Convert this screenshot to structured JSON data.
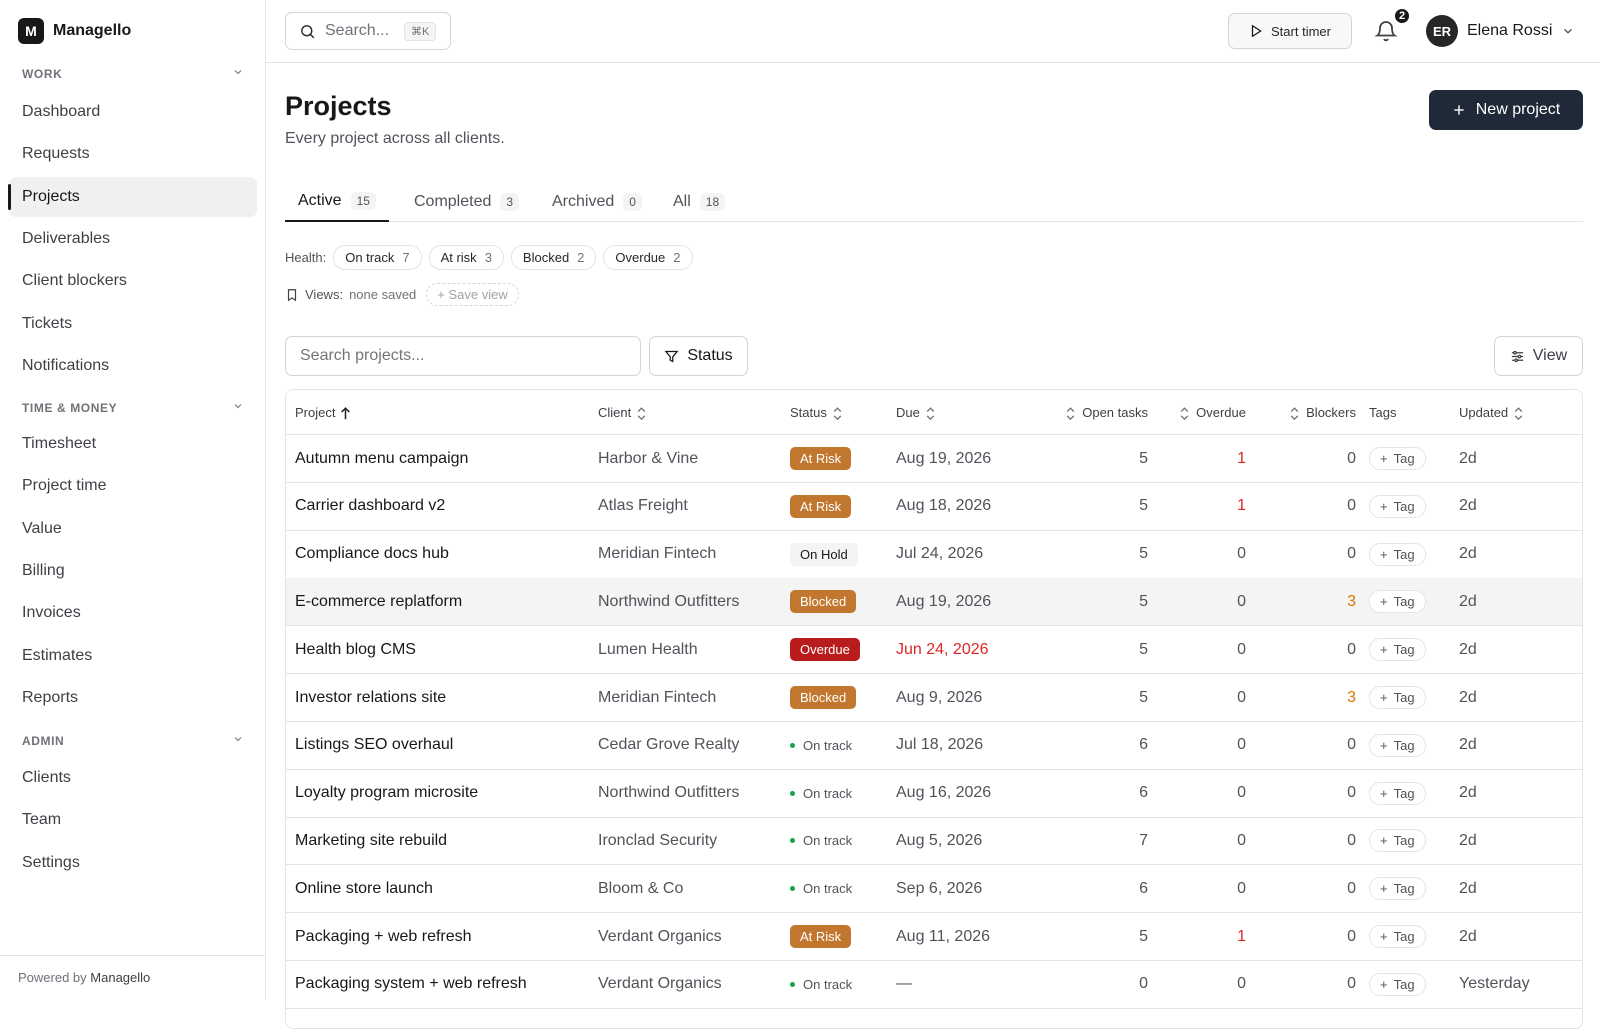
{
  "brand": {
    "logo_letter": "M",
    "name": "Managello"
  },
  "sidebar": {
    "sections": [
      {
        "title": "WORK",
        "items": [
          "Dashboard",
          "Requests",
          "Projects",
          "Deliverables",
          "Client blockers",
          "Tickets",
          "Notifications"
        ]
      },
      {
        "title": "TIME & MONEY",
        "items": [
          "Timesheet",
          "Project time",
          "Value",
          "Billing",
          "Invoices",
          "Estimates",
          "Reports"
        ]
      },
      {
        "title": "ADMIN",
        "items": [
          "Clients",
          "Team",
          "Settings"
        ]
      }
    ],
    "active_item": "Projects",
    "footer_prefix": "Powered by",
    "footer_brand": "Managello"
  },
  "topbar": {
    "search_placeholder": "Search...",
    "search_shortcut": "⌘K",
    "timer_label": "Start timer",
    "notification_count": "2",
    "user_initials": "ER",
    "user_name": "Elena Rossi"
  },
  "page": {
    "title": "Projects",
    "subtitle": "Every project across all clients.",
    "new_button": "New project"
  },
  "tabs": [
    {
      "label": "Active",
      "count": "15"
    },
    {
      "label": "Completed",
      "count": "3"
    },
    {
      "label": "Archived",
      "count": "0"
    },
    {
      "label": "All",
      "count": "18"
    }
  ],
  "health": {
    "label": "Health:",
    "chips": [
      {
        "label": "On track",
        "count": "7"
      },
      {
        "label": "At risk",
        "count": "3"
      },
      {
        "label": "Blocked",
        "count": "2"
      },
      {
        "label": "Overdue",
        "count": "2"
      }
    ]
  },
  "views": {
    "label": "Views:",
    "value": "none saved",
    "save_label": "Save view"
  },
  "filters": {
    "search_placeholder": "Search projects...",
    "status_button": "Status",
    "view_button": "View"
  },
  "table": {
    "columns": [
      "Project",
      "Client",
      "Status",
      "Due",
      "Open tasks",
      "Overdue",
      "Blockers",
      "Tags",
      "Updated"
    ],
    "tag_button": "Tag",
    "rows": [
      {
        "project": "Autumn menu campaign",
        "client": "Harbor & Vine",
        "status": "At Risk",
        "due": "Aug 19, 2026",
        "open": "5",
        "overdue": "1",
        "blockers": "0",
        "updated": "2d"
      },
      {
        "project": "Carrier dashboard v2",
        "client": "Atlas Freight",
        "status": "At Risk",
        "due": "Aug 18, 2026",
        "open": "5",
        "overdue": "1",
        "blockers": "0",
        "updated": "2d"
      },
      {
        "project": "Compliance docs hub",
        "client": "Meridian Fintech",
        "status": "On Hold",
        "due": "Jul 24, 2026",
        "open": "5",
        "overdue": "0",
        "blockers": "0",
        "updated": "2d"
      },
      {
        "project": "E-commerce replatform",
        "client": "Northwind Outfitters",
        "status": "Blocked",
        "due": "Aug 19, 2026",
        "open": "5",
        "overdue": "0",
        "blockers": "3",
        "updated": "2d"
      },
      {
        "project": "Health blog CMS",
        "client": "Lumen Health",
        "status": "Overdue",
        "due": "Jun 24, 2026",
        "open": "5",
        "overdue": "0",
        "blockers": "0",
        "updated": "2d"
      },
      {
        "project": "Investor relations site",
        "client": "Meridian Fintech",
        "status": "Blocked",
        "due": "Aug 9, 2026",
        "open": "5",
        "overdue": "0",
        "blockers": "3",
        "updated": "2d"
      },
      {
        "project": "Listings SEO overhaul",
        "client": "Cedar Grove Realty",
        "status": "On track",
        "due": "Jul 18, 2026",
        "open": "6",
        "overdue": "0",
        "blockers": "0",
        "updated": "2d"
      },
      {
        "project": "Loyalty program microsite",
        "client": "Northwind Outfitters",
        "status": "On track",
        "due": "Aug 16, 2026",
        "open": "6",
        "overdue": "0",
        "blockers": "0",
        "updated": "2d"
      },
      {
        "project": "Marketing site rebuild",
        "client": "Ironclad Security",
        "status": "On track",
        "due": "Aug 5, 2026",
        "open": "7",
        "overdue": "0",
        "blockers": "0",
        "updated": "2d"
      },
      {
        "project": "Online store launch",
        "client": "Bloom & Co",
        "status": "On track",
        "due": "Sep 6, 2026",
        "open": "6",
        "overdue": "0",
        "blockers": "0",
        "updated": "2d"
      },
      {
        "project": "Packaging + web refresh",
        "client": "Verdant Organics",
        "status": "At Risk",
        "due": "Aug 11, 2026",
        "open": "5",
        "overdue": "1",
        "blockers": "0",
        "updated": "2d"
      },
      {
        "project": "Packaging system + web refresh",
        "client": "Verdant Organics",
        "status": "On track",
        "due": "—",
        "open": "0",
        "overdue": "0",
        "blockers": "0",
        "updated": "Yesterday"
      }
    ]
  },
  "colors": {
    "accent": "#1f2937",
    "at_risk": "#c2772f",
    "overdue": "#b91c1c",
    "on_track": "#16a34a",
    "danger_text": "#dc2626",
    "warning_text": "#d97706"
  }
}
